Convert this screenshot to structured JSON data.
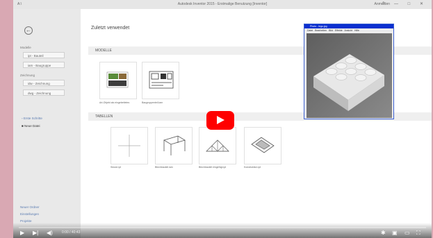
{
  "window": {
    "app_label": "A:\\",
    "title": "Autodesk Inventor 2015 - Erstmalige Benutzung [Inventor]",
    "title_right": "Anmelden",
    "buttons": [
      "?",
      "—",
      "□",
      "✕"
    ]
  },
  "sidebar": {
    "back_symbol": "←",
    "section_1_label": "Modelle",
    "section_1_items": [
      "ipt - Bauteil",
      "iam - Baugruppe"
    ],
    "section_2_label": "Zeichnung",
    "section_2_items": [
      "idw - Zeichnung",
      "dwg - Zeichnung"
    ],
    "nav_items": [
      "Erste Schritte",
      "Neue Datei"
    ],
    "footer_links": [
      "Neuer Ordner",
      "Einstellungen",
      "Projekte"
    ]
  },
  "main": {
    "heading": "Zuletzt verwendet",
    "sections": [
      {
        "label": "MODELLE",
        "items": [
          {
            "caption": "Art-Objekt als eingebettetes"
          },
          {
            "caption": "Baugruppenteil.iam"
          }
        ]
      },
      {
        "label": "TABELLEN",
        "items": [
          {
            "caption": "Skizze.ipt"
          },
          {
            "caption": "Blechbauteil.iam"
          },
          {
            "caption": "Blechbauteil eingefügt.ipt"
          },
          {
            "caption": "Konstruktion.ipt"
          }
        ]
      }
    ]
  },
  "photo_window": {
    "title": "Photo - lego.jpg",
    "menu": [
      "Datei",
      "Bearbeiten",
      "Bild",
      "Effekte",
      "Ansicht",
      "Hilfe"
    ]
  },
  "video": {
    "timecode": "0:00 / 40:43",
    "progress": 0.0,
    "accent_color": "#ff0000"
  }
}
